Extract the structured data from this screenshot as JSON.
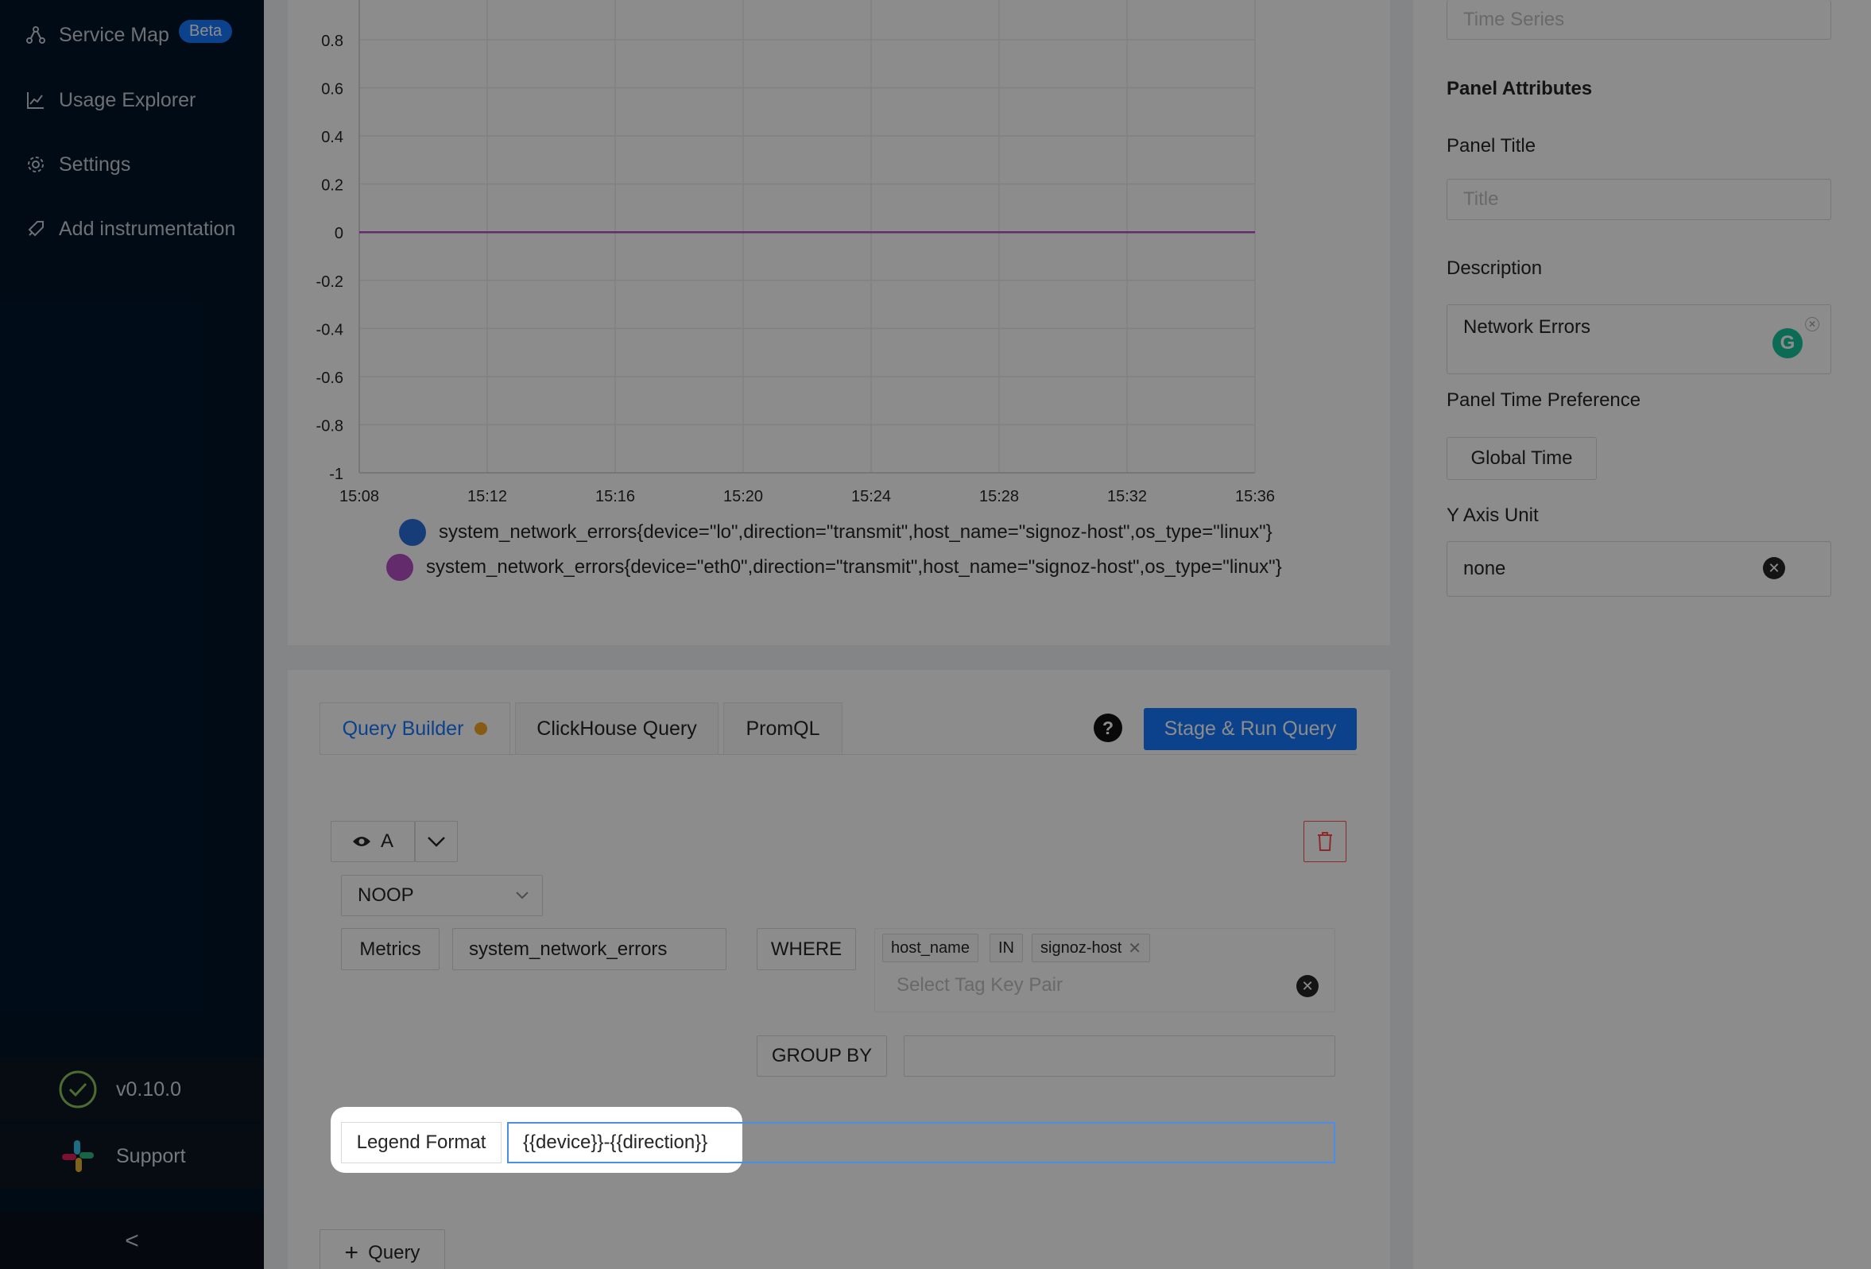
{
  "sidebar": {
    "items": [
      {
        "label": "Service Map",
        "badge": "Beta",
        "icon": "service-map-icon"
      },
      {
        "label": "Usage Explorer",
        "icon": "line-chart-icon"
      },
      {
        "label": "Settings",
        "icon": "gear-icon"
      },
      {
        "label": "Add instrumentation",
        "icon": "rocket-icon"
      }
    ],
    "version": "v0.10.0",
    "support": "Support",
    "collapse": "<"
  },
  "chart_data": {
    "type": "line",
    "x": [
      "15:08",
      "15:12",
      "15:16",
      "15:20",
      "15:24",
      "15:28",
      "15:32",
      "15:36"
    ],
    "y_ticks": [
      "0.8",
      "0.6",
      "0.4",
      "0.2",
      "0",
      "-0.2",
      "-0.4",
      "-0.6",
      "-0.8",
      "-1"
    ],
    "ylim": [
      -1,
      0.8
    ],
    "grid": true,
    "series": [
      {
        "name": "system_network_errors{device=\"lo\",direction=\"transmit\",host_name=\"signoz-host\",os_type=\"linux\"}",
        "color": "#2a6fdb",
        "values": [
          0,
          0,
          0,
          0,
          0,
          0,
          0,
          0
        ]
      },
      {
        "name": "system_network_errors{device=\"eth0\",direction=\"transmit\",host_name=\"signoz-host\",os_type=\"linux\"}",
        "color": "#b44fc4",
        "values": [
          0,
          0,
          0,
          0,
          0,
          0,
          0,
          0
        ]
      }
    ]
  },
  "query": {
    "tabs": [
      "Query Builder",
      "ClickHouse Query",
      "PromQL"
    ],
    "help": "?",
    "run_button": "Stage & Run Query",
    "query_name": "A",
    "aggregation": "NOOP",
    "metrics_label": "Metrics",
    "metric_name": "system_network_errors",
    "where_label": "WHERE",
    "tags": [
      "host_name",
      "IN",
      "signoz-host"
    ],
    "tag_placeholder": "Select Tag Key Pair",
    "group_by_label": "GROUP BY",
    "legend_label": "Legend Format",
    "legend_value": "{{device}}-{{direction}}",
    "add_query": "Query"
  },
  "panel": {
    "type_value": "Time Series",
    "section_title": "Panel Attributes",
    "title_label": "Panel Title",
    "title_placeholder": "Title",
    "description_label": "Description",
    "description_value": "Network Errors",
    "time_pref_label": "Panel Time Preference",
    "time_pref_value": "Global Time",
    "y_unit_label": "Y Axis Unit",
    "y_unit_value": "none"
  }
}
